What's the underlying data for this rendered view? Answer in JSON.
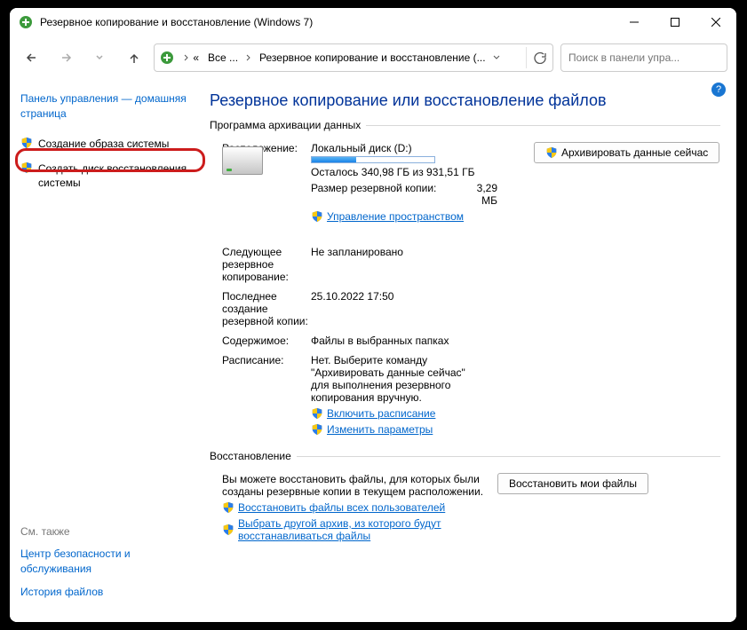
{
  "titlebar": {
    "title": "Резервное копирование и восстановление (Windows 7)"
  },
  "nav": {
    "crumb_all": "Все ...",
    "crumb_here": "Резервное копирование и восстановление (...",
    "search_placeholder": "Поиск в панели упра..."
  },
  "sidebar": {
    "home": "Панель управления — домашняя страница",
    "link_create_image": "Создание образа системы",
    "link_create_disc": "Создать диск восстановления системы",
    "see_also_hdr": "См. также",
    "see_also_security": "Центр безопасности и обслуживания",
    "see_also_history": "История файлов"
  },
  "content": {
    "heading": "Резервное копирование или восстановление файлов",
    "fs_backup": "Программа архивации данных",
    "loc_lbl": "Расположение:",
    "loc_val": "Локальный диск (D:)",
    "loc_free": "Осталось 340,98 ГБ из 931,51 ГБ",
    "size_lbl": "Размер резервной копии:",
    "size_val": "3,29 МБ",
    "manage_space": "Управление пространством",
    "backup_now_btn": "Архивировать данные сейчас",
    "next_lbl": "Следующее резервное копирование:",
    "next_val": "Не запланировано",
    "last_lbl": "Последнее создание резервной копии:",
    "last_val": "25.10.2022 17:50",
    "what_lbl": "Содержимое:",
    "what_val": "Файлы в выбранных папках",
    "sched_lbl": "Расписание:",
    "sched_val": "Нет. Выберите команду \"Архивировать данные сейчас\" для выполнения резервного копирования вручную.",
    "enable_sched": "Включить расписание",
    "change_params": "Изменить параметры",
    "fs_restore": "Восстановление",
    "restore_desc": "Вы можете восстановить файлы, для которых были созданы резервные копии в текущем расположении.",
    "restore_btn": "Восстановить мои файлы",
    "restore_all_users": "Восстановить файлы всех пользователей",
    "choose_other": "Выбрать другой архив, из которого будут восстанавливаться файлы"
  }
}
